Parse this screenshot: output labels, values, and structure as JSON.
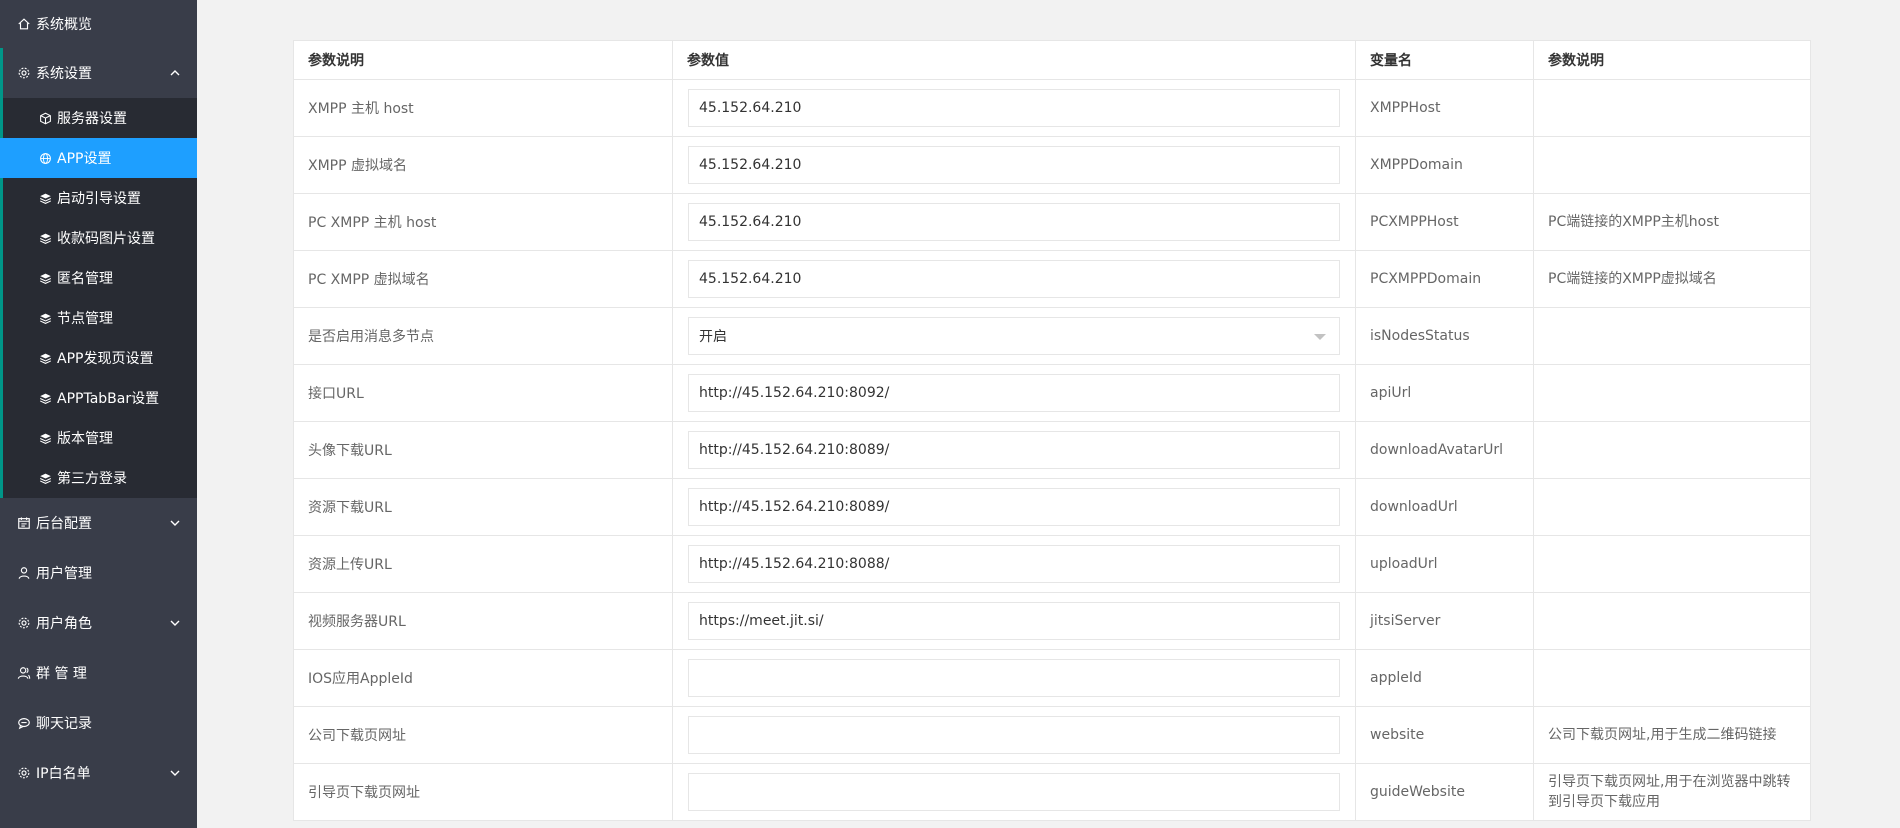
{
  "sidebar": {
    "overview": {
      "label": "系统概览",
      "icon": "home-icon"
    },
    "system_settings": {
      "label": "系统设置",
      "icon": "gear-icon"
    },
    "sub_items": [
      {
        "label": "服务器设置",
        "icon": "cube-icon"
      },
      {
        "label": "APP设置",
        "icon": "globe-icon"
      },
      {
        "label": "启动引导设置",
        "icon": "layers-icon"
      },
      {
        "label": "收款码图片设置",
        "icon": "layers-icon"
      },
      {
        "label": "匿名管理",
        "icon": "layers-icon"
      },
      {
        "label": "节点管理",
        "icon": "layers-icon"
      },
      {
        "label": "APP发现页设置",
        "icon": "layers-icon"
      },
      {
        "label": "APPTabBar设置",
        "icon": "layers-icon"
      },
      {
        "label": "版本管理",
        "icon": "layers-icon"
      },
      {
        "label": "第三方登录",
        "icon": "layers-icon"
      }
    ],
    "backend_config": {
      "label": "后台配置",
      "icon": "calendar-icon"
    },
    "user_mgmt": {
      "label": "用户管理",
      "icon": "user-icon"
    },
    "user_roles": {
      "label": "用户角色",
      "icon": "gear-icon"
    },
    "group_mgmt": {
      "label": "群 管 理",
      "icon": "group-icon"
    },
    "chat_log": {
      "label": "聊天记录",
      "icon": "chat-icon"
    },
    "ip_whitelist": {
      "label": "IP白名单",
      "icon": "gear-icon"
    },
    "active_color": "#1e9fff",
    "bg_color": "#393d49",
    "sub_bg_color": "#282b33"
  },
  "table": {
    "headers": [
      "参数说明",
      "参数值",
      "变量名",
      "参数说明"
    ],
    "rows": [
      {
        "label": "XMPP 主机 host",
        "value": "45.152.64.210",
        "var": "XMPPHost",
        "desc": ""
      },
      {
        "label": "XMPP 虚拟域名",
        "value": "45.152.64.210",
        "var": "XMPPDomain",
        "desc": ""
      },
      {
        "label": "PC XMPP 主机 host",
        "value": "45.152.64.210",
        "var": "PCXMPPHost",
        "desc": "PC端链接的XMPP主机host"
      },
      {
        "label": "PC XMPP 虚拟域名",
        "value": "45.152.64.210",
        "var": "PCXMPPDomain",
        "desc": "PC端链接的XMPP虚拟域名"
      },
      {
        "label": "是否启用消息多节点",
        "value": "开启",
        "var": "isNodesStatus",
        "desc": "",
        "type": "select"
      },
      {
        "label": "接口URL",
        "value": "http://45.152.64.210:8092/",
        "var": "apiUrl",
        "desc": ""
      },
      {
        "label": "头像下载URL",
        "value": "http://45.152.64.210:8089/",
        "var": "downloadAvatarUrl",
        "desc": ""
      },
      {
        "label": "资源下载URL",
        "value": "http://45.152.64.210:8089/",
        "var": "downloadUrl",
        "desc": ""
      },
      {
        "label": "资源上传URL",
        "value": "http://45.152.64.210:8088/",
        "var": "uploadUrl",
        "desc": ""
      },
      {
        "label": "视频服务器URL",
        "value": "https://meet.jit.si/",
        "var": "jitsiServer",
        "desc": ""
      },
      {
        "label": "IOS应用AppleId",
        "value": "",
        "var": "appleId",
        "desc": ""
      },
      {
        "label": "公司下载页网址",
        "value": "",
        "var": "website",
        "desc": "公司下载页网址,用于生成二维码链接"
      },
      {
        "label": "引导页下载页网址",
        "value": "",
        "var": "guideWebsite",
        "desc": "引导页下载页网址,用于在浏览器中跳转到引导页下载应用"
      }
    ]
  }
}
